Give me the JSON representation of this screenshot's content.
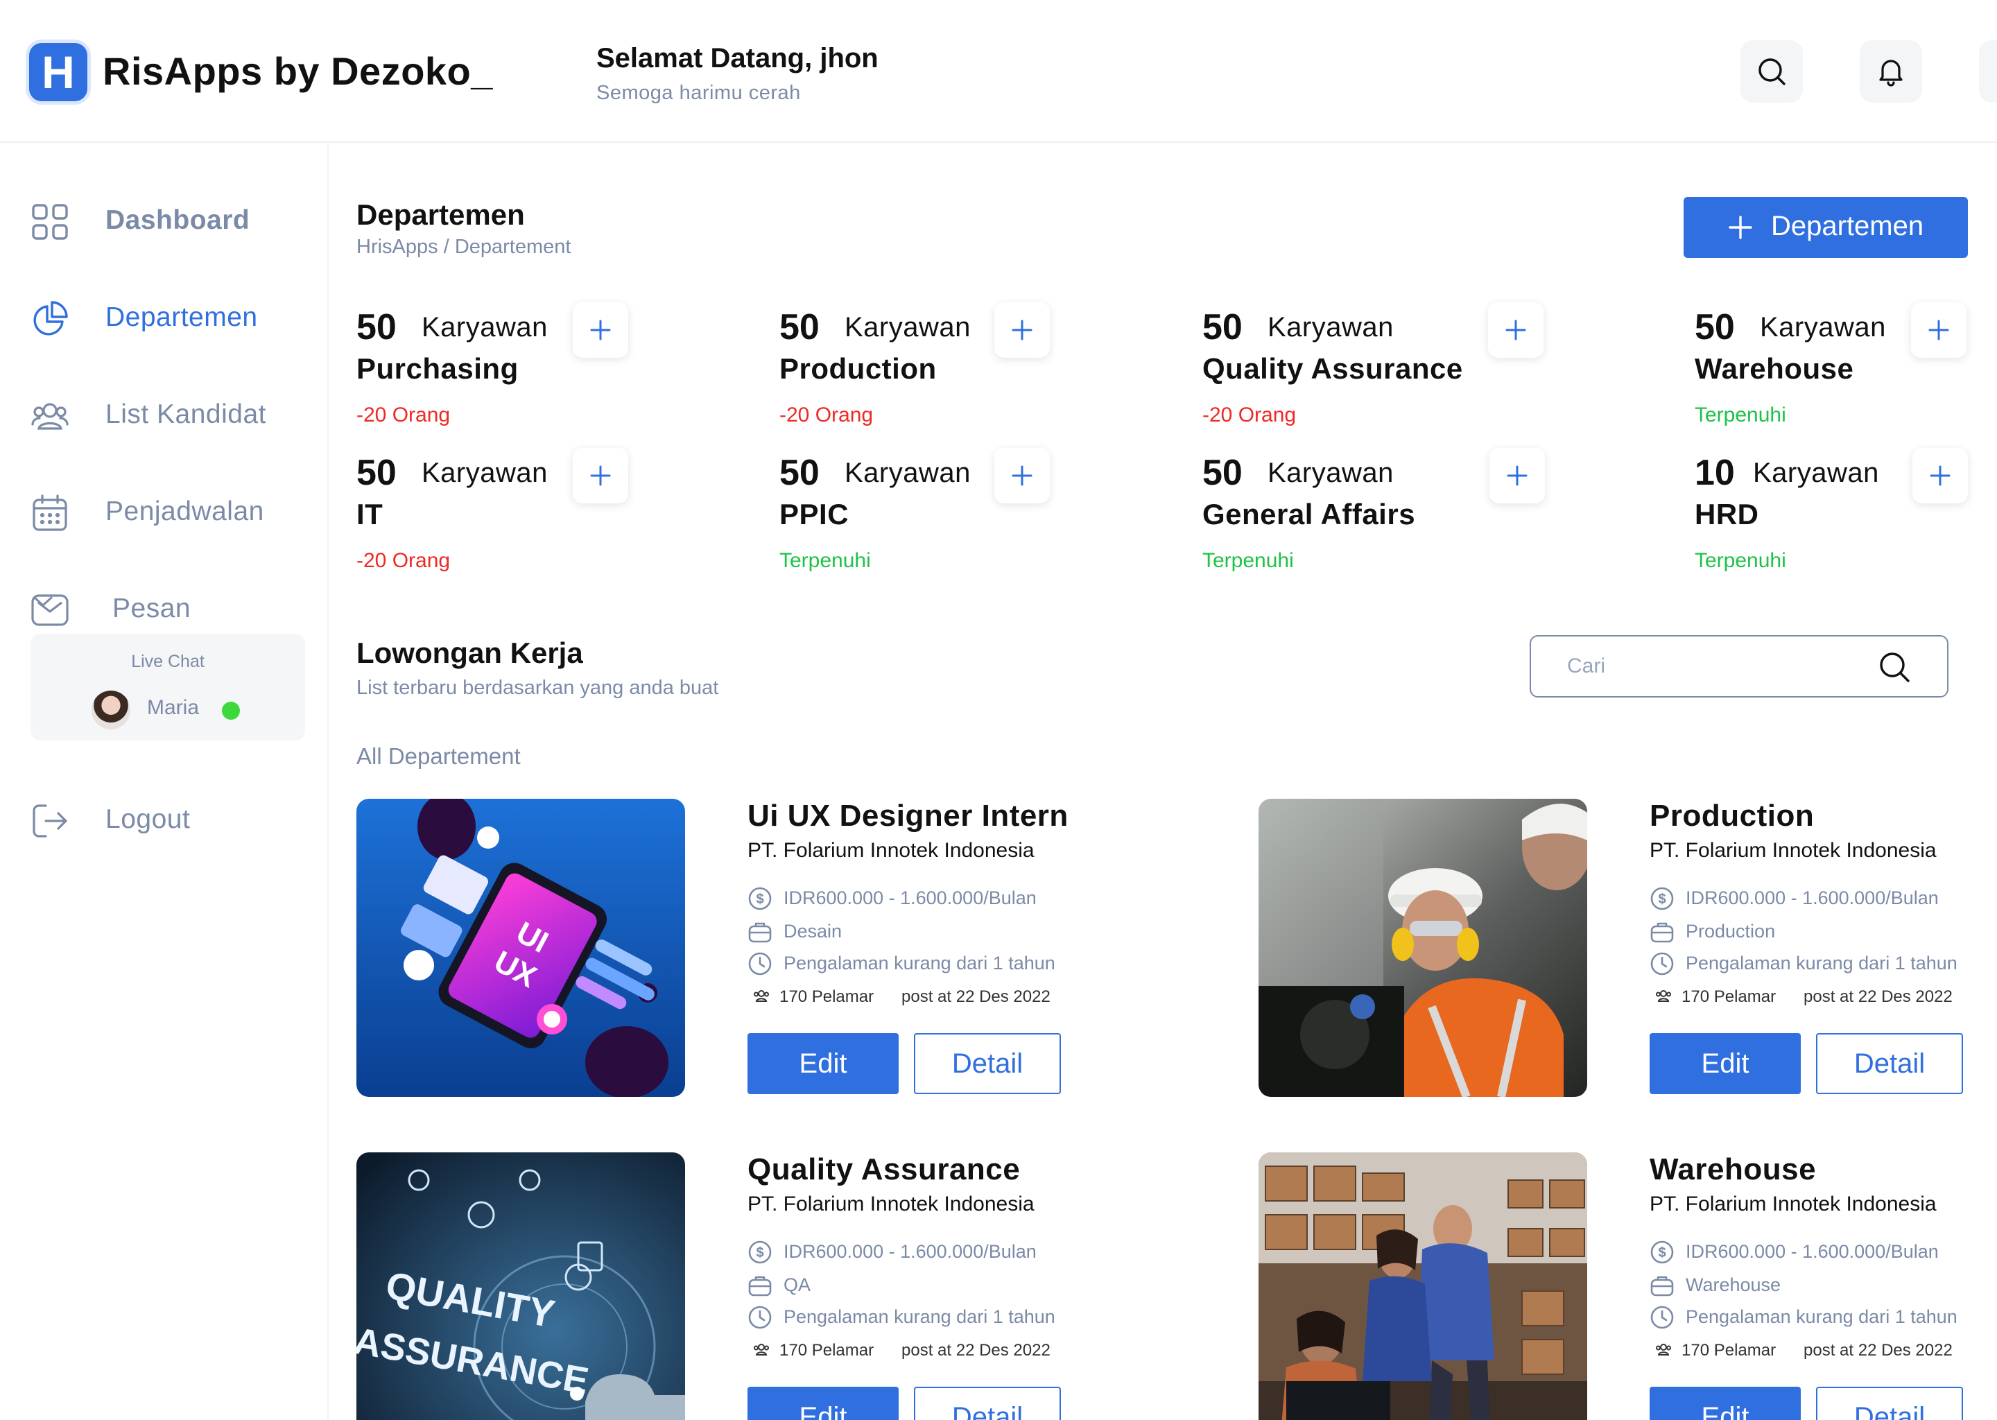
{
  "header": {
    "logo_letter": "H",
    "app_title": "RisApps by Dezoko_",
    "greeting": "Selamat Datang, jhon",
    "greeting_sub": "Semoga harimu cerah"
  },
  "sidebar": {
    "items": [
      {
        "label": "Dashboard",
        "icon": "grid-icon"
      },
      {
        "label": "Departemen",
        "icon": "pie-chart-icon",
        "active": true
      },
      {
        "label": "List Kandidat",
        "icon": "users-icon"
      },
      {
        "label": "Penjadwalan",
        "icon": "calendar-icon"
      },
      {
        "label": "Pesan",
        "icon": "mail-icon"
      },
      {
        "label": "Logout",
        "icon": "logout-icon"
      }
    ],
    "live_chat": {
      "title": "Live Chat",
      "name": "Maria"
    }
  },
  "main": {
    "title": "Departemen",
    "breadcrumb": "HrisApps / Departement",
    "add_button": "Departemen",
    "departments": [
      {
        "count": "50",
        "unit": "Karyawan",
        "name": "Purchasing",
        "status": "-20 Orang",
        "state": "short"
      },
      {
        "count": "50",
        "unit": "Karyawan",
        "name": "Production",
        "status": "-20 Orang",
        "state": "short"
      },
      {
        "count": "50",
        "unit": "Karyawan",
        "name": "Quality Assurance",
        "status": "-20 Orang",
        "state": "short"
      },
      {
        "count": "50",
        "unit": "Karyawan",
        "name": "Warehouse",
        "status": "Terpenuhi",
        "state": "full"
      },
      {
        "count": "50",
        "unit": "Karyawan",
        "name": "IT",
        "status": "-20 Orang",
        "state": "short"
      },
      {
        "count": "50",
        "unit": "Karyawan",
        "name": "PPIC",
        "status": "Terpenuhi",
        "state": "full"
      },
      {
        "count": "50",
        "unit": "Karyawan",
        "name": "General Affairs",
        "status": "Terpenuhi",
        "state": "full"
      },
      {
        "count": "10",
        "unit": "Karyawan",
        "name": "HRD",
        "status": "Terpenuhi",
        "state": "full"
      }
    ],
    "jobs_section": {
      "title": "Lowongan Kerja",
      "subtitle": "List terbaru berdasarkan yang anda buat",
      "search_placeholder": "Cari",
      "filter": "All Departement"
    },
    "jobs": [
      {
        "title": "Ui UX Designer Intern",
        "company": "PT. Folarium Innotek Indonesia",
        "salary": "IDR600.000 - 1.600.000/Bulan",
        "category": "Desain",
        "experience": "Pengalaman kurang dari 1 tahun",
        "applicants": "170 Pelamar",
        "posted": "post at 22 Des 2022",
        "edit": "Edit",
        "detail": "Detail"
      },
      {
        "title": "Production",
        "company": "PT. Folarium Innotek Indonesia",
        "salary": "IDR600.000 - 1.600.000/Bulan",
        "category": "Production",
        "experience": "Pengalaman kurang dari 1 tahun",
        "applicants": "170 Pelamar",
        "posted": "post at 22 Des 2022",
        "edit": "Edit",
        "detail": "Detail"
      },
      {
        "title": "Quality Assurance",
        "company": "PT. Folarium Innotek Indonesia",
        "salary": "IDR600.000 - 1.600.000/Bulan",
        "category": "QA",
        "experience": "Pengalaman kurang dari 1 tahun",
        "applicants": "170 Pelamar",
        "posted": "post at 22 Des 2022",
        "edit": "Edit",
        "detail": "Detail"
      },
      {
        "title": "Warehouse",
        "company": "PT. Folarium Innotek Indonesia",
        "salary": "IDR600.000 - 1.600.000/Bulan",
        "category": "Warehouse",
        "experience": "Pengalaman kurang dari 1 tahun",
        "applicants": "170 Pelamar",
        "posted": "post at 22 Des 2022",
        "edit": "Edit",
        "detail": "Detail"
      }
    ]
  },
  "image_art": {
    "uiux_a": "UI",
    "uiux_b": "UX",
    "qa_a": "QUALITY",
    "qa_b": "ASSURANCE"
  },
  "colors": {
    "primary": "#2f6fdf",
    "muted": "#7b8aa6",
    "danger": "#ee2a24",
    "success": "#1ec247"
  }
}
